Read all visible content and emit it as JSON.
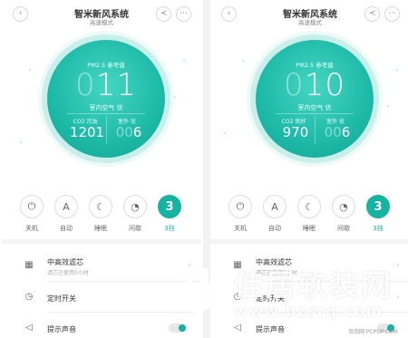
{
  "app": {
    "title": "智米新风系统",
    "subtitle": "高速模式"
  },
  "icons": {
    "back": "back-icon",
    "share": "share-icon",
    "more": "more-icon"
  },
  "colors": {
    "accent": "#17b3a2",
    "gauge": "#1eb9a8"
  },
  "screens": [
    {
      "pm_label": "PM2.5 参考值",
      "pm_dim": "0",
      "pm_value": "11",
      "indoor": "室内空气 优",
      "co2_label": "CO2 污浊",
      "co2_value": "1201",
      "outdoor_label": "室外 优",
      "outdoor_dim": "00",
      "outdoor_value": "6"
    },
    {
      "pm_label": "PM2.5 参考值",
      "pm_dim": "0",
      "pm_value": "10",
      "indoor": "室内空气 优",
      "co2_label": "CO2 良好",
      "co2_value": "970",
      "outdoor_label": "室外 优",
      "outdoor_dim": "00",
      "outdoor_value": "6"
    }
  ],
  "modes": [
    {
      "icon": "power-icon",
      "glyph": "⏻",
      "label": "关机"
    },
    {
      "icon": "auto-icon",
      "glyph": "A",
      "label": "自动"
    },
    {
      "icon": "moon-icon",
      "glyph": "☾",
      "label": "睡眠"
    },
    {
      "icon": "intermittent-icon",
      "glyph": "◔",
      "label": "间歇"
    },
    {
      "icon": "level-icon",
      "glyph": "3",
      "label": "3挡",
      "active": true
    }
  ],
  "settings": {
    "filter_title": "中高效滤芯",
    "filter_sub": "滤芯已使用0小时",
    "timer_title": "定时开关",
    "sound_title": "提示声音"
  },
  "watermark": {
    "text": "佳居软装网",
    "url": "www.bzsrq.com",
    "credit": "泡泡网 PCPOP.COM"
  }
}
